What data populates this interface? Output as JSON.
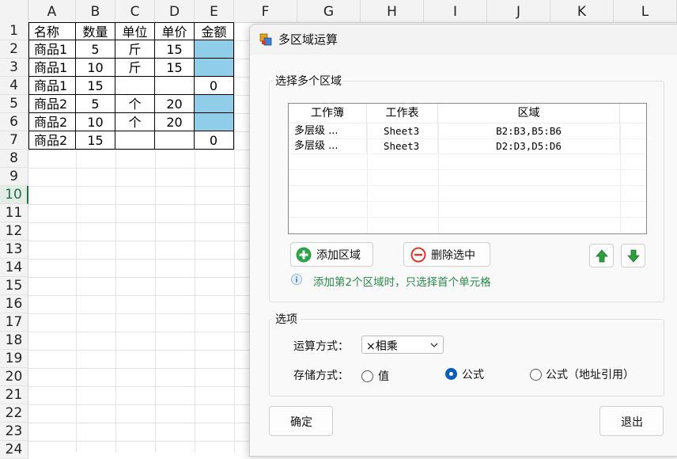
{
  "spreadsheet": {
    "columns": [
      "A",
      "B",
      "C",
      "D",
      "E",
      "F",
      "G",
      "H",
      "I",
      "J",
      "K",
      "L"
    ],
    "rows": [
      "1",
      "2",
      "3",
      "4",
      "5",
      "6",
      "7",
      "8",
      "9",
      "10",
      "11",
      "12",
      "13",
      "14",
      "15",
      "16",
      "17",
      "18",
      "19",
      "20",
      "21",
      "22",
      "23",
      "24"
    ],
    "selected_row": "10",
    "cells": [
      [
        "名称",
        "数量",
        "单位",
        "单价",
        "金额"
      ],
      [
        "商品1",
        "5",
        "斤",
        "15",
        ""
      ],
      [
        "商品1",
        "10",
        "斤",
        "15",
        ""
      ],
      [
        "商品1",
        "15",
        "",
        "",
        "0"
      ],
      [
        "商品2",
        "5",
        "个",
        "20",
        ""
      ],
      [
        "商品2",
        "10",
        "个",
        "20",
        ""
      ],
      [
        "商品2",
        "15",
        "",
        "",
        "0"
      ]
    ],
    "highlight_color": "#8fcde8"
  },
  "dialog": {
    "title": "多区域运算",
    "select_group_label": "选择多个区域",
    "table": {
      "headers": [
        "工作簿",
        "工作表",
        "区域"
      ],
      "rows": [
        [
          "多层级 ...",
          "Sheet3",
          "B2:B3,B5:B6"
        ],
        [
          "多层级 ...",
          "Sheet3",
          "D2:D3,D5:D6"
        ]
      ]
    },
    "add_button": "添加区域",
    "delete_button": "删除选中",
    "hint": "添加第2个区域时，只选择首个单元格",
    "options_group_label": "选项",
    "operation_label": "运算方式：",
    "operation_value": "×相乘",
    "storage_label": "存储方式：",
    "storage_options": [
      "值",
      "公式",
      "公式（地址引用）"
    ],
    "storage_selected": "公式",
    "ok_button": "确定",
    "exit_button": "退出",
    "accent_color": "#0a5fb8",
    "hint_color": "#2a8a4a"
  }
}
